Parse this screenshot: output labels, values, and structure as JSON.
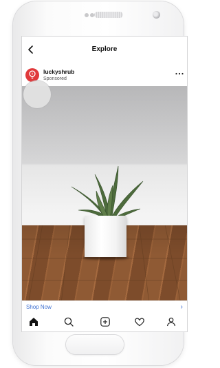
{
  "nav": {
    "title": "Explore",
    "back_icon": "chevron-left-icon"
  },
  "post": {
    "username": "luckyshrub",
    "sponsored_label": "Sponsored",
    "avatar_icon": "lightbulb-logo-icon",
    "more_icon": "more-horizontal-icon",
    "cta_label": "Shop Now",
    "cta_icon": "chevron-right-icon"
  },
  "tabs": [
    {
      "name": "home",
      "icon": "home-icon",
      "active": true
    },
    {
      "name": "search",
      "icon": "search-icon",
      "active": false
    },
    {
      "name": "create",
      "icon": "plus-square-icon",
      "active": false
    },
    {
      "name": "activity",
      "icon": "heart-icon",
      "active": false
    },
    {
      "name": "profile",
      "icon": "profile-icon",
      "active": false
    }
  ],
  "colors": {
    "brand_red": "#e0393b",
    "link_blue": "#3c6fd1",
    "text": "#111111"
  }
}
